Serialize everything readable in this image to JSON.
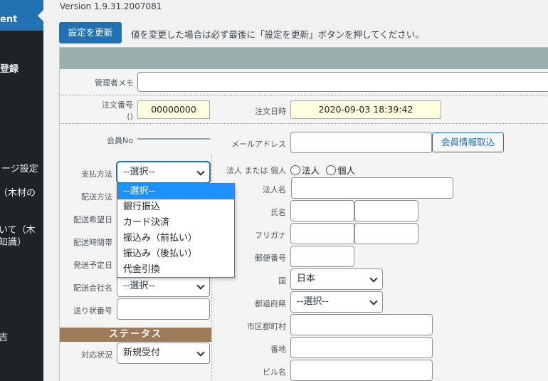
{
  "sidebar": {
    "current": "ent",
    "items": [
      "登録",
      "ージ設定",
      "（木材の",
      "いて（木",
      "知識）",
      "吉"
    ]
  },
  "header": {
    "version": "Version 1.9.31.2007081",
    "update_button": "設定を更新",
    "update_note": "値を変更した場合は必ず最後に「設定を更新」ボタンを押してください。"
  },
  "memo": {
    "label": "管理者メモ",
    "value": ""
  },
  "order": {
    "number_label": "注文番号",
    "number_sub": "()",
    "number_value": "00000000",
    "date_label": "注文日時",
    "date_value": "2020-09-03 18:39:42"
  },
  "member": {
    "no_label": "会員No",
    "email_label": "メールアドレス",
    "email_value": "",
    "fetch_button": "会員情報取込"
  },
  "left": {
    "payment_label": "支払方法",
    "payment_value": "--選択--",
    "shipping_method_label": "配送方法",
    "delivery_date_label": "配送希望日",
    "delivery_time_label": "配送時間帯",
    "ship_plan_label": "発送予定日",
    "carrier_label": "配送会社名",
    "carrier_value": "--選択--",
    "tracking_label": "送り状番号",
    "tracking_value": "",
    "status_header": "ステータス",
    "status_label": "対応状況",
    "status_value": "新規受付"
  },
  "right": {
    "entity_label": "法人 または 個人",
    "entity_corp": "法人",
    "entity_person": "個人",
    "corp_name_label": "法人名",
    "name_label": "氏名",
    "kana_label": "フリガナ",
    "zip_label": "郵便番号",
    "country_label": "国",
    "country_value": "日本",
    "pref_label": "都道府県",
    "pref_value": "--選択--",
    "city_label": "市区郡町村",
    "address_label": "番地",
    "building_label": "ビル名"
  },
  "payment_options": [
    "--選択--",
    "銀行振込",
    "カード決済",
    "振込み（前払い）",
    "振込み（後払い）",
    "代金引換"
  ]
}
